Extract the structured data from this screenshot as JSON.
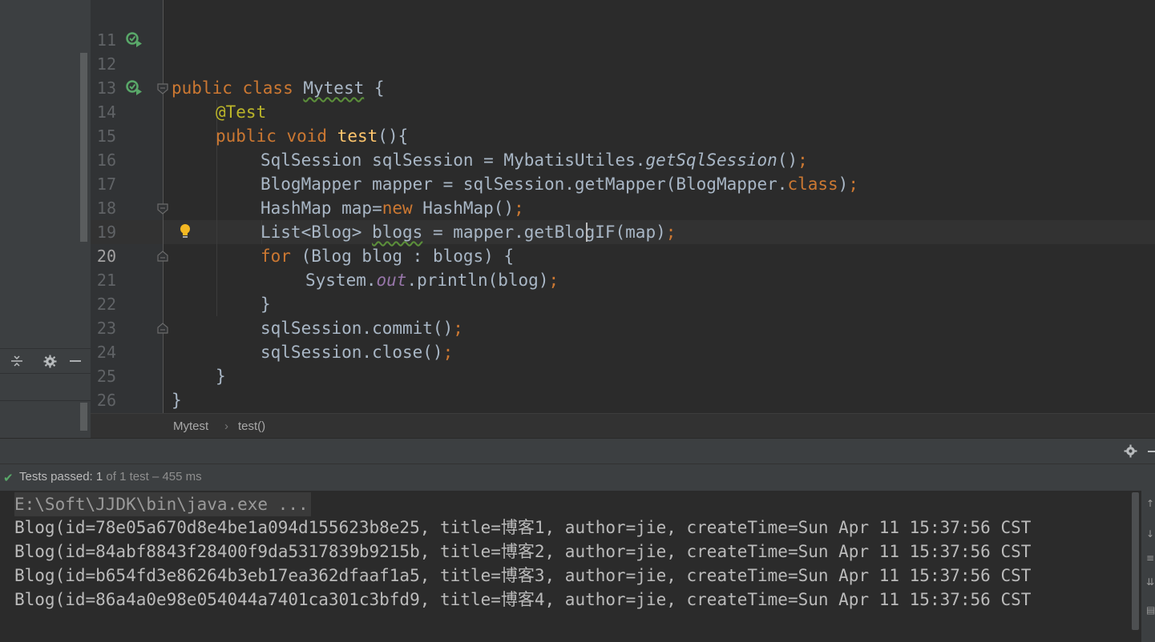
{
  "sidebar": {
    "icons": [
      "collapse-icon",
      "gear-icon",
      "minimize-icon"
    ]
  },
  "editor": {
    "lines": [
      {
        "num": "11"
      },
      {
        "num": "12"
      },
      {
        "num": "13"
      },
      {
        "num": "14"
      },
      {
        "num": "15"
      },
      {
        "num": "16"
      },
      {
        "num": "17"
      },
      {
        "num": "18"
      },
      {
        "num": "19"
      },
      {
        "num": "20"
      },
      {
        "num": "21"
      },
      {
        "num": "22"
      },
      {
        "num": "23"
      },
      {
        "num": "24"
      },
      {
        "num": "25"
      },
      {
        "num": "26"
      }
    ],
    "code": {
      "l12_kw": "public class ",
      "l12_name": "Mytest",
      "l12_rest": " {",
      "l13": "@Test",
      "l14_kw": "public void ",
      "l14_fn": "test",
      "l14_rest": "(){",
      "l15_a": "SqlSession sqlSession = MybatisUtiles.",
      "l15_b": "getSqlSession",
      "l15_c": "()",
      "l15_semi": ";",
      "l16_a": "BlogMapper mapper = sqlSession.getMapper(BlogMapper.",
      "l16_kw": "class",
      "l16_b": ")",
      "l16_semi": ";",
      "l17_a": "HashMap map=",
      "l17_kw": "new ",
      "l17_b": "HashMap()",
      "l17_semi": ";",
      "l18_a": "List<Blog> ",
      "l18_var": "blogs",
      "l18_b": " = mapper.getBlogIF(map)",
      "l18_semi": ";",
      "l19_kw": "for ",
      "l19_b": "(Blog blog : blogs) {",
      "l20_a": "System.",
      "l20_out": "out",
      "l20_b": ".println(blog)",
      "l20_semi": ";",
      "l21": "}",
      "l22_a": "sqlSession.commit()",
      "l22_semi": ";",
      "l23_a": "sqlSession.close()",
      "l23_semi": ";",
      "l24": "}",
      "l25": "}"
    }
  },
  "breadcrumb": {
    "class_name": "Mytest",
    "separator": "›",
    "method_name": "test()"
  },
  "run": {
    "status_prefix": "Tests passed: ",
    "status_count": "1",
    "status_of": " of 1 test",
    "status_time": " – 455 ms",
    "command": "E:\\Soft\\JJDK\\bin\\java.exe ...",
    "output": [
      "Blog(id=78e05a670d8e4be1a094d155623b8e25, title=博客1, author=jie, createTime=Sun Apr 11 15:37:56 CST",
      "Blog(id=84abf8843f28400f9da5317839b9215b, title=博客2, author=jie, createTime=Sun Apr 11 15:37:56 CST",
      "Blog(id=b654fd3e86264b3eb17ea362dfaaf1a5, title=博客3, author=jie, createTime=Sun Apr 11 15:37:56 CST",
      "Blog(id=86a4a0e98e054044a7401ca301c3bfd9, title=博客4, author=jie, createTime=Sun Apr 11 15:37:56 CST"
    ]
  },
  "colors": {
    "keyword": "#cc7832",
    "function": "#ffc66d",
    "annotation": "#bbb529",
    "field": "#9876aa",
    "text": "#a9b7c6",
    "pass": "#59a869"
  }
}
